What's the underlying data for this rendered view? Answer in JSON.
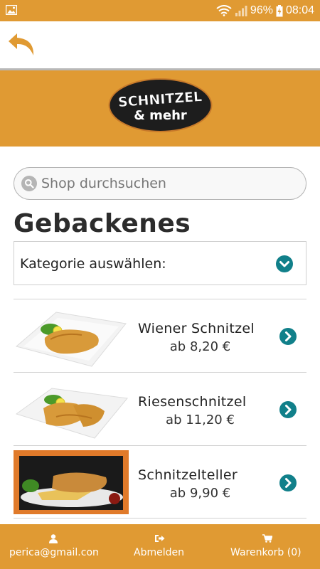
{
  "status_bar": {
    "battery": "96%",
    "time": "08:04"
  },
  "header": {
    "logo_line1": "SCHNITZEL",
    "logo_line2": "& mehr"
  },
  "search": {
    "placeholder": "Shop durchsuchen"
  },
  "page": {
    "title": "Gebackenes",
    "category_label": "Kategorie auswählen:"
  },
  "products": [
    {
      "name": "Wiener Schnitzel",
      "price": "ab 8,20 €"
    },
    {
      "name": "Riesenschnitzel",
      "price": "ab 11,20 €"
    },
    {
      "name": "Schnitzelteller",
      "price": "ab 9,90 €"
    }
  ],
  "bottom_nav": {
    "account": "perica@gmail.com",
    "logout": "Abmelden",
    "cart": "Warenkorb (0)"
  },
  "colors": {
    "accent": "#e09a33",
    "action_teal": "#11808a"
  }
}
